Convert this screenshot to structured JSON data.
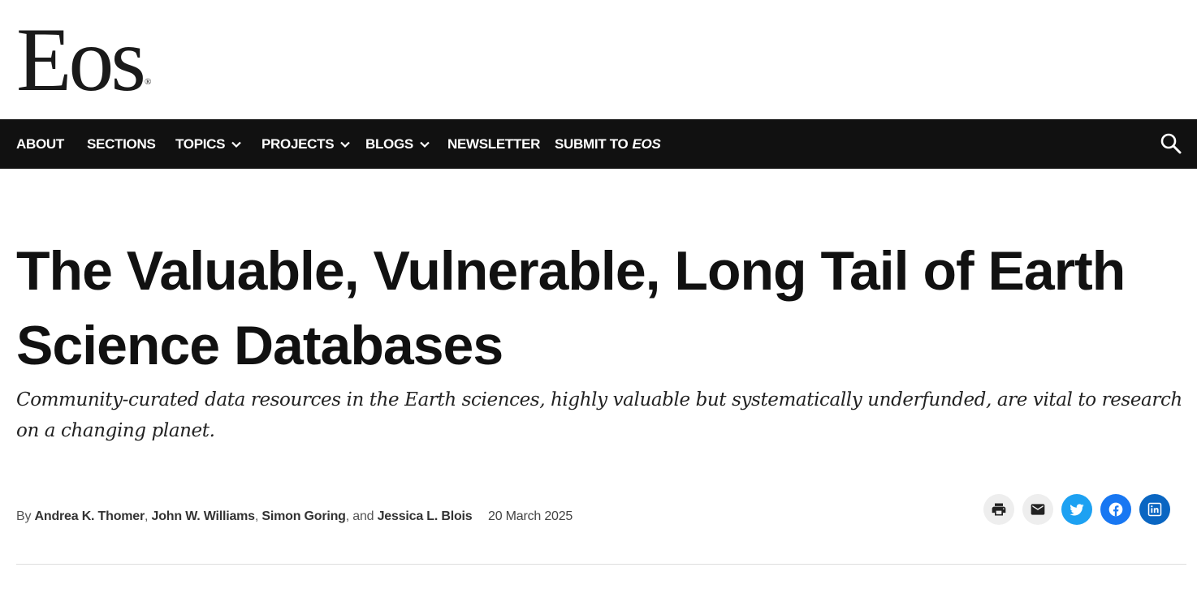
{
  "logo": {
    "text": "Eos",
    "mark": "®"
  },
  "nav": {
    "items": [
      {
        "label": "ABOUT"
      },
      {
        "label": "SECTIONS"
      },
      {
        "label": "TOPICS",
        "dropdown": true
      },
      {
        "label": "PROJECTS",
        "dropdown": true
      },
      {
        "label": "BLOGS",
        "dropdown": true
      },
      {
        "label": "NEWSLETTER"
      },
      {
        "label": "SUBMIT TO",
        "emphasis": "EOS"
      }
    ],
    "search_icon": "search-icon"
  },
  "article": {
    "title": "The Valuable, Vulnerable, Long Tail of Earth Science Databases",
    "dek": "Community-curated data resources in the Earth sciences, highly valuable but systematically underfunded, are vital to research on a changing planet.",
    "byline": {
      "prefix": "By",
      "authors": [
        "Andrea K. Thomer",
        "John W. Williams",
        "Simon Goring",
        "Jessica L. Blois"
      ],
      "sep_comma": ",",
      "sep_and": ", and"
    },
    "date": "20 March 2025"
  },
  "share": [
    {
      "name": "print",
      "icon": "print-icon",
      "bg": "#eeeeee",
      "fg": "#222222"
    },
    {
      "name": "email",
      "icon": "mail-icon",
      "bg": "#eeeeee",
      "fg": "#222222"
    },
    {
      "name": "twitter",
      "icon": "twitter-icon",
      "bg": "#1da1f2",
      "fg": "#ffffff"
    },
    {
      "name": "facebook",
      "icon": "facebook-icon",
      "bg": "#1877f2",
      "fg": "#ffffff"
    },
    {
      "name": "linkedin",
      "icon": "linkedin-icon",
      "bg": "#0a66c2",
      "fg": "#ffffff"
    }
  ],
  "colors": {
    "nav_bg": "#111111",
    "nav_text": "#ffffff",
    "divider": "#dddddd"
  }
}
